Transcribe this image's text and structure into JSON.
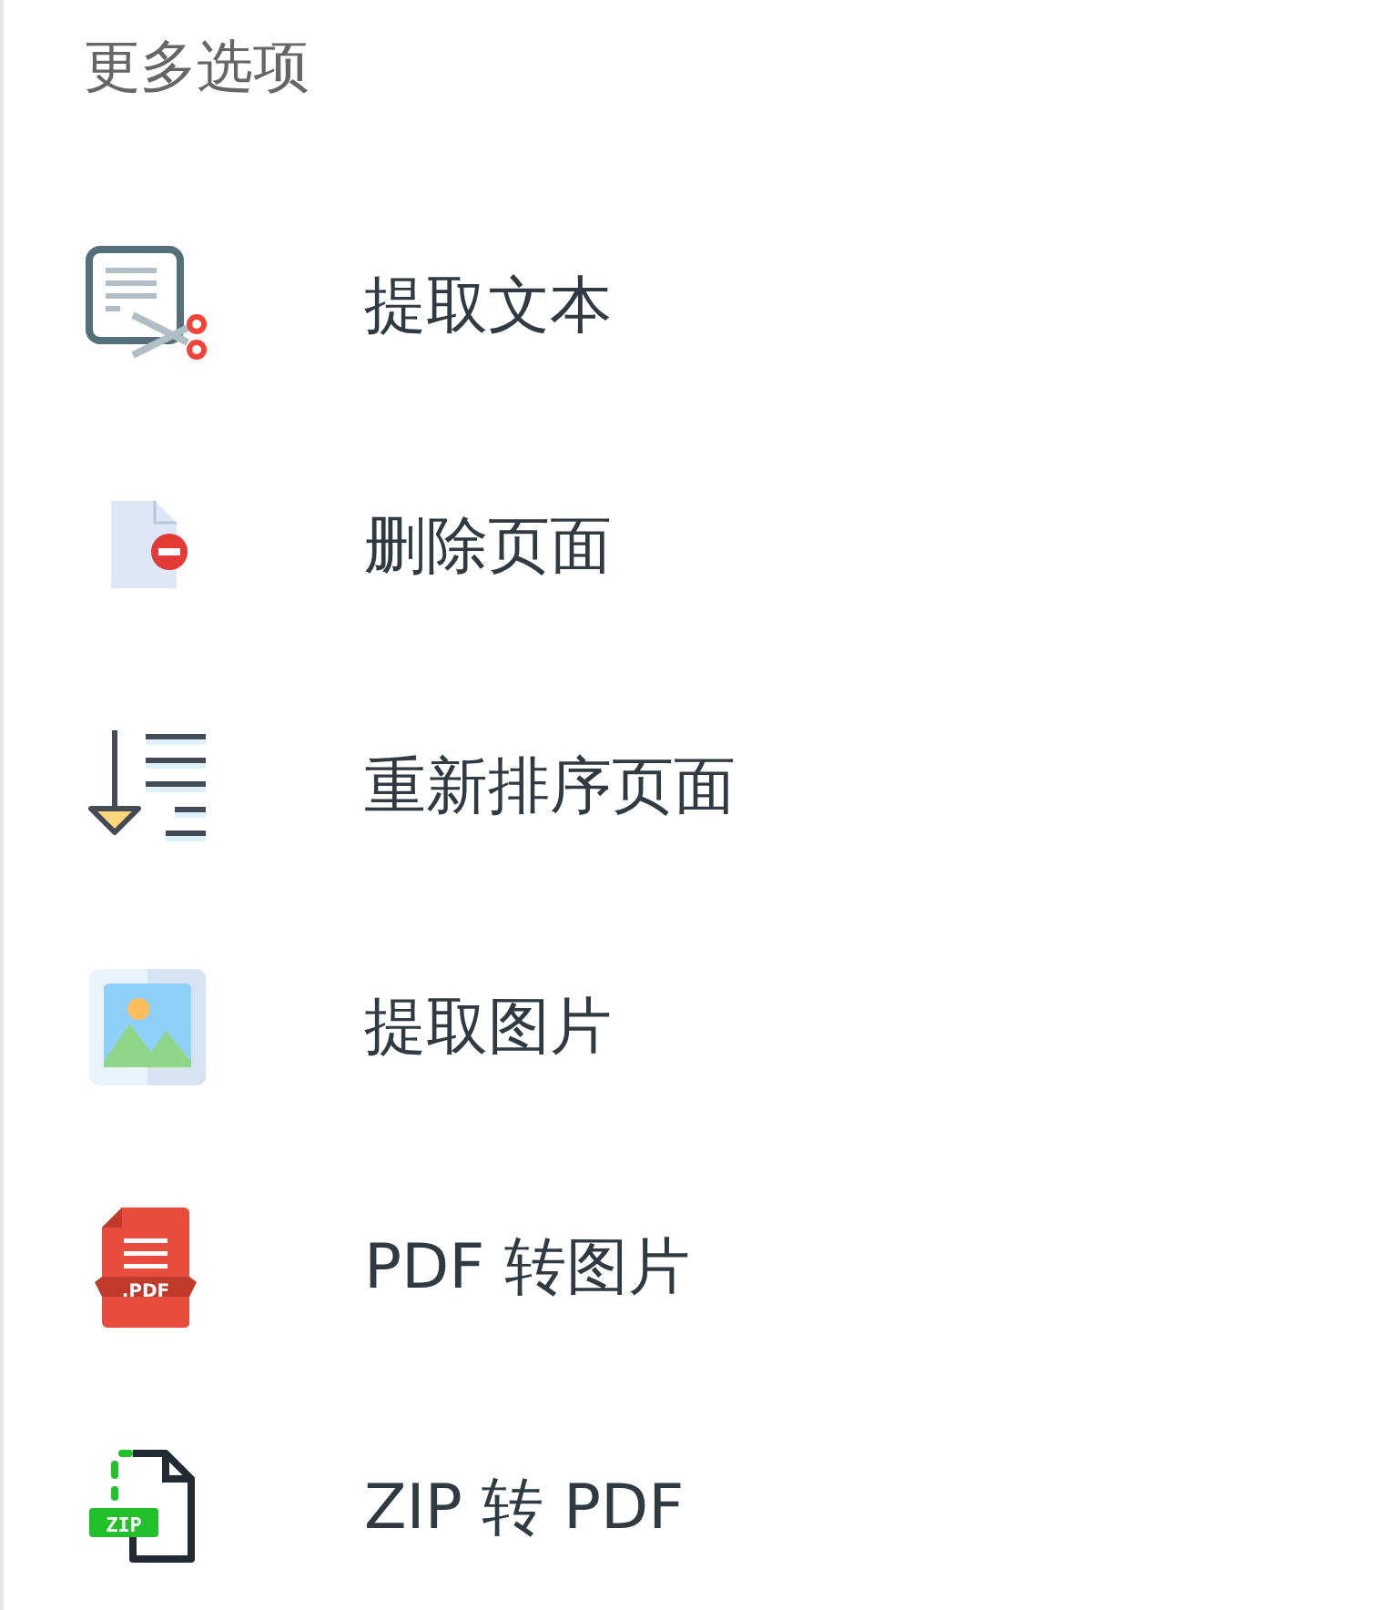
{
  "title": "更多选项",
  "items": [
    {
      "kind": "extract-text",
      "label": "提取文本"
    },
    {
      "kind": "delete-page",
      "label": "删除页面"
    },
    {
      "kind": "reorder",
      "label": "重新排序页面"
    },
    {
      "kind": "extract-image",
      "label": "提取图片"
    },
    {
      "kind": "pdf-file",
      "label": "PDF 转图片",
      "badge": ".PDF"
    },
    {
      "kind": "zip-file",
      "label": "ZIP 转 PDF",
      "badge": "ZIP"
    }
  ]
}
